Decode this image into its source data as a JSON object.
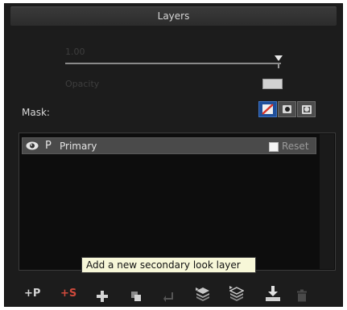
{
  "panel": {
    "title": "Layers"
  },
  "opacity": {
    "value": "1.00",
    "label": "Opacity"
  },
  "mask": {
    "label": "Mask:"
  },
  "layers": [
    {
      "type": "P",
      "name": "Primary",
      "reset_label": "Reset"
    }
  ],
  "tooltip": {
    "text": "Add a new secondary look layer"
  },
  "toolbar": {
    "add_primary_label": "+P",
    "add_secondary_label": "+S"
  }
}
